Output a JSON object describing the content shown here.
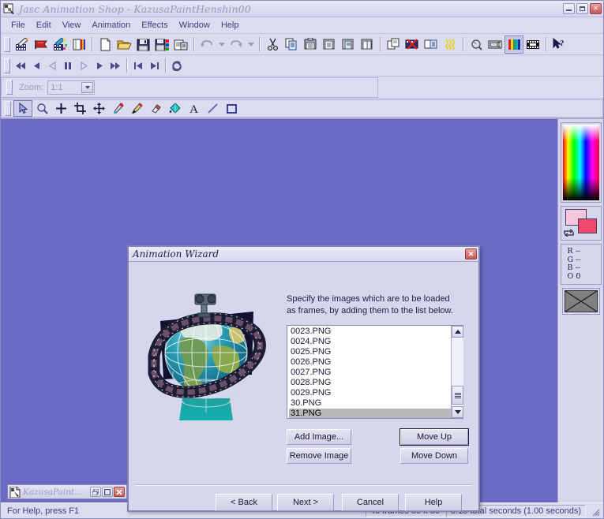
{
  "window": {
    "title": "Jasc Animation Shop - KazusaPaintHenshin00",
    "icon": "animation-shop-icon",
    "controls": {
      "minimize": "minimize-icon",
      "maximize": "maximize-icon",
      "close": "close-icon"
    }
  },
  "menubar": {
    "items": [
      {
        "label": "File"
      },
      {
        "label": "Edit"
      },
      {
        "label": "View"
      },
      {
        "label": "Animation"
      },
      {
        "label": "Effects"
      },
      {
        "label": "Window"
      },
      {
        "label": "Help"
      }
    ]
  },
  "toolbar_main": {
    "groups": [
      [
        {
          "name": "animation-wizard-icon",
          "title": "Animation Wizard"
        },
        {
          "name": "banner-wizard-icon",
          "title": "Banner Wizard"
        },
        {
          "name": "animation-quality-wizard-icon",
          "title": "Animation Quality Wizard"
        },
        {
          "name": "optimization-wizard-icon",
          "title": "Optimization Wizard"
        }
      ],
      [
        {
          "name": "new-icon",
          "title": "New"
        },
        {
          "name": "open-icon",
          "title": "Open"
        },
        {
          "name": "save-icon",
          "title": "Save"
        },
        {
          "name": "save-as-icon",
          "title": "Save As"
        },
        {
          "name": "save-frames-icon",
          "title": "Save Frames As"
        }
      ],
      [
        {
          "name": "undo-icon",
          "title": "Undo",
          "disabled": true
        },
        {
          "name": "undo-dropdown-icon",
          "title": "Undo History",
          "disabled": true
        },
        {
          "name": "redo-icon",
          "title": "Redo",
          "disabled": true
        },
        {
          "name": "redo-dropdown-icon",
          "title": "Redo History",
          "disabled": true
        }
      ],
      [
        {
          "name": "cut-icon",
          "title": "Cut"
        },
        {
          "name": "copy-icon",
          "title": "Copy"
        },
        {
          "name": "paste-icon",
          "title": "Paste"
        },
        {
          "name": "paste-as-new-animation-icon",
          "title": "Paste As New Animation"
        },
        {
          "name": "paste-into-selected-frame-icon",
          "title": "Paste Into Selected Frame"
        },
        {
          "name": "paste-before-current-frame-icon",
          "title": "Paste Before Current Frame"
        }
      ],
      [
        {
          "name": "duplicate-frame-icon",
          "title": "Duplicate Selected Frames"
        },
        {
          "name": "delete-frame-icon",
          "title": "Delete Frames"
        },
        {
          "name": "insert-frames-icon",
          "title": "Insert Frames"
        },
        {
          "name": "animation-effect-icon",
          "title": "Insert Image Effect"
        }
      ],
      [
        {
          "name": "propagate-paste-icon",
          "title": "Propagate Paste"
        },
        {
          "name": "frame-properties-icon",
          "title": "Frame Properties"
        },
        {
          "name": "color-palette-icon",
          "title": "Animation Properties"
        },
        {
          "name": "view-animation-icon",
          "title": "View Animation"
        }
      ],
      [
        {
          "name": "help-pointer-icon",
          "title": "Context Help"
        }
      ]
    ]
  },
  "toolbar_playback": {
    "buttons": [
      {
        "name": "rewind-to-start-icon",
        "title": "First Frame"
      },
      {
        "name": "step-back-icon",
        "title": "Previous Frame"
      },
      {
        "name": "play-reverse-icon",
        "title": "Play Reverse",
        "disabled": true
      },
      {
        "name": "pause-icon",
        "title": "Stop"
      },
      {
        "name": "play-outline-icon",
        "title": "Play",
        "disabled": true
      },
      {
        "name": "play-icon",
        "title": "Play Animation"
      },
      {
        "name": "fast-forward-icon",
        "title": "Last Frame"
      },
      {
        "name": "frame-back-icon",
        "title": "Step Back One Frame"
      },
      {
        "name": "frame-forward-icon",
        "title": "Step Forward One Frame"
      },
      {
        "name": "loop-icon",
        "title": "Loop"
      }
    ]
  },
  "toolbar_zoom": {
    "label": "Zoom:",
    "value": "1:1",
    "disabled": true,
    "dropdown_icon": "chevron-down-icon"
  },
  "tool_palette": {
    "tools": [
      {
        "name": "arrow-tool-icon",
        "title": "Arrow",
        "selected": true
      },
      {
        "name": "zoom-tool-icon",
        "title": "Zoom"
      },
      {
        "name": "mover-tool-icon",
        "title": "Mover"
      },
      {
        "name": "crop-tool-icon",
        "title": "Crop"
      },
      {
        "name": "pan-tool-icon",
        "title": "Pan"
      },
      {
        "name": "dropper-tool-icon",
        "title": "Dropper"
      },
      {
        "name": "paintbrush-tool-icon",
        "title": "Paint Brush"
      },
      {
        "name": "eraser-tool-icon",
        "title": "Eraser"
      },
      {
        "name": "fill-tool-icon",
        "title": "Flood Fill"
      },
      {
        "name": "text-tool-icon",
        "title": "Text"
      },
      {
        "name": "line-tool-icon",
        "title": "Draw"
      },
      {
        "name": "shape-tool-icon",
        "title": "Preset Shapes"
      }
    ]
  },
  "color_panel": {
    "rainbow_name": "color-spectrum-picker",
    "foreground_color": "#f6c6dd",
    "background_color": "#f0486e",
    "swap_icon": "swap-colors-icon",
    "readout": [
      {
        "channel": "R",
        "value": "--"
      },
      {
        "channel": "G",
        "value": "--"
      },
      {
        "channel": "B",
        "value": "--"
      },
      {
        "channel": "O",
        "value": "0"
      }
    ],
    "null_swatch_name": "transparent-swatch"
  },
  "mdi_child": {
    "title": "KazusaPaint...",
    "icon": "document-icon",
    "controls": {
      "restore": "restore-icon",
      "maximize": "maximize-icon",
      "close": "close-icon"
    }
  },
  "statusbar": {
    "help_text": "For Help, press F1",
    "panes": [
      {
        "text": "40 frames   50 x 50"
      },
      {
        "text": "8.15 total seconds   (1.00 seconds)"
      }
    ],
    "grip_name": "resize-grip"
  },
  "dialog": {
    "title": "Animation Wizard",
    "close_icon": "close-icon",
    "illustration_name": "globe-filmstrip-illustration",
    "instruction": "Specify the images which are to be loaded as frames, by adding them to the list below.",
    "instruction_line1": "Specify the images which are to be loaded",
    "instruction_line2": "as frames, by adding them to the list below.",
    "listbox": {
      "items": [
        {
          "label": "0023.PNG",
          "selected": false
        },
        {
          "label": "0024.PNG",
          "selected": false
        },
        {
          "label": "0025.PNG",
          "selected": false
        },
        {
          "label": "0026.PNG",
          "selected": false
        },
        {
          "label": "0027.PNG",
          "selected": false
        },
        {
          "label": "0028.PNG",
          "selected": false
        },
        {
          "label": "0029.PNG",
          "selected": false
        },
        {
          "label": "30.PNG",
          "selected": false
        },
        {
          "label": "31.PNG",
          "selected": true
        }
      ],
      "scroll_up_icon": "chevron-up-icon",
      "scroll_down_icon": "chevron-down-icon"
    },
    "buttons": {
      "add_image": "Add Image...",
      "remove_image": "Remove Image",
      "move_up": "Move Up",
      "move_down": "Move Down",
      "back": "< Back",
      "next": "Next >",
      "cancel": "Cancel",
      "help": "Help"
    }
  }
}
